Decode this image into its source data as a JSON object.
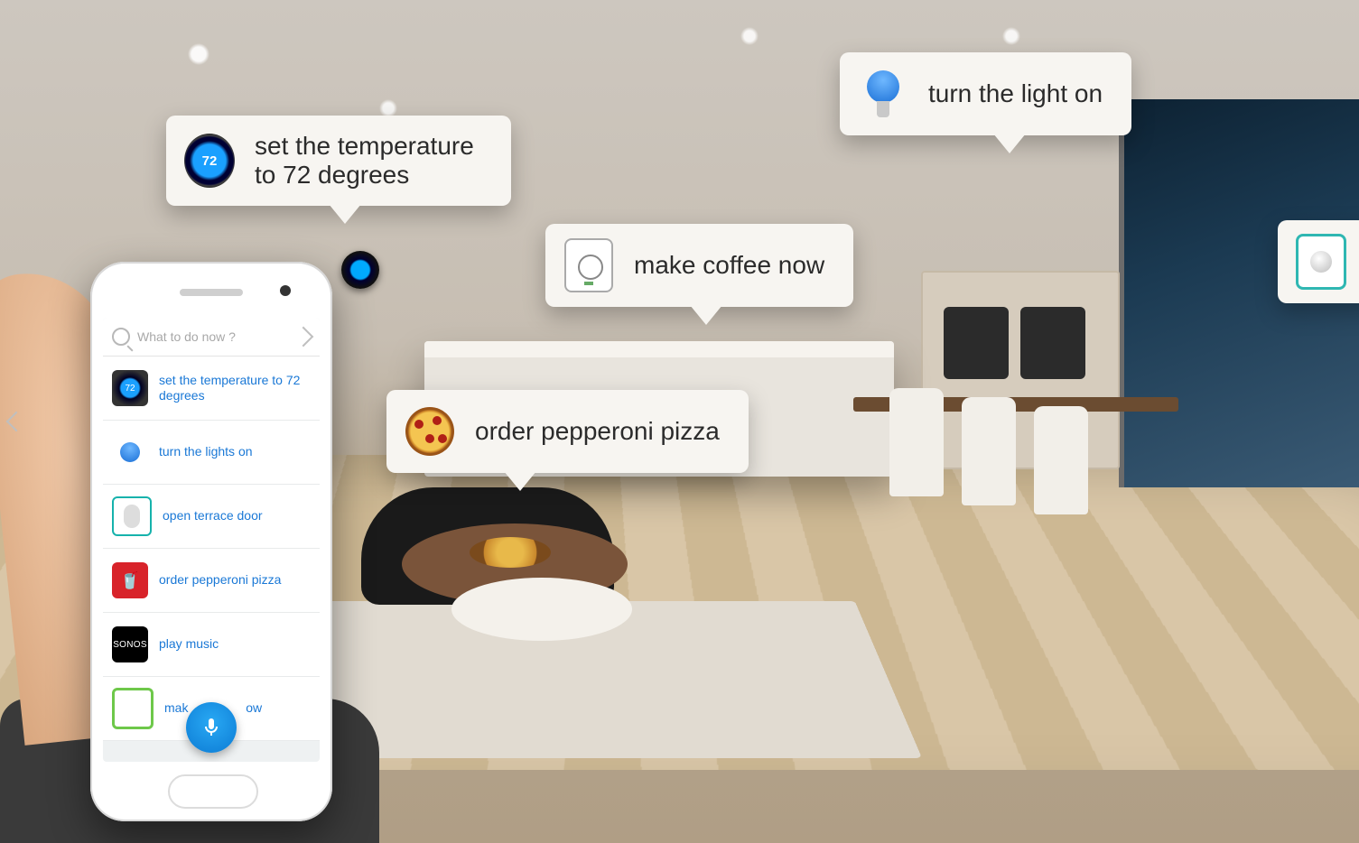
{
  "bubbles": {
    "thermostat": {
      "text": "set the temperature to 72 degrees",
      "iconValue": "72"
    },
    "light": {
      "text": "turn the light on"
    },
    "coffee": {
      "text": "make coffee now"
    },
    "pizza": {
      "text": "order pepperoni pizza"
    },
    "dial": {
      "text": ""
    }
  },
  "phone": {
    "search": {
      "placeholder": "What to do now ?"
    },
    "items": [
      {
        "label": "set the temperature to 72 degrees"
      },
      {
        "label": "turn the lights on"
      },
      {
        "label": "open terrace door"
      },
      {
        "label": "order pepperoni pizza"
      },
      {
        "label": "play music"
      },
      {
        "label": "mak",
        "label2": "ow"
      }
    ],
    "sonosLabel": "SONOS"
  }
}
